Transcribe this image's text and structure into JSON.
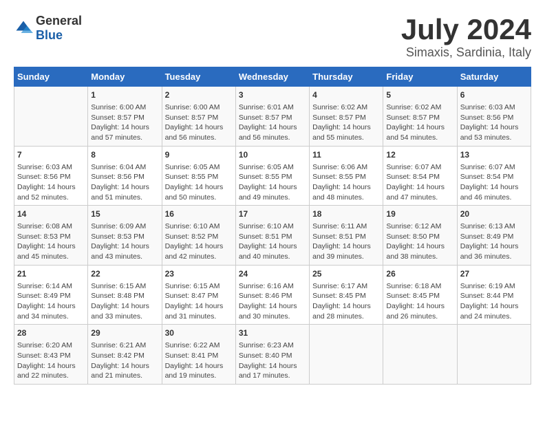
{
  "logo": {
    "text_general": "General",
    "text_blue": "Blue"
  },
  "title": "July 2024",
  "subtitle": "Simaxis, Sardinia, Italy",
  "headers": [
    "Sunday",
    "Monday",
    "Tuesday",
    "Wednesday",
    "Thursday",
    "Friday",
    "Saturday"
  ],
  "weeks": [
    [
      {
        "day": "",
        "content": ""
      },
      {
        "day": "1",
        "content": "Sunrise: 6:00 AM\nSunset: 8:57 PM\nDaylight: 14 hours\nand 57 minutes."
      },
      {
        "day": "2",
        "content": "Sunrise: 6:00 AM\nSunset: 8:57 PM\nDaylight: 14 hours\nand 56 minutes."
      },
      {
        "day": "3",
        "content": "Sunrise: 6:01 AM\nSunset: 8:57 PM\nDaylight: 14 hours\nand 56 minutes."
      },
      {
        "day": "4",
        "content": "Sunrise: 6:02 AM\nSunset: 8:57 PM\nDaylight: 14 hours\nand 55 minutes."
      },
      {
        "day": "5",
        "content": "Sunrise: 6:02 AM\nSunset: 8:57 PM\nDaylight: 14 hours\nand 54 minutes."
      },
      {
        "day": "6",
        "content": "Sunrise: 6:03 AM\nSunset: 8:56 PM\nDaylight: 14 hours\nand 53 minutes."
      }
    ],
    [
      {
        "day": "7",
        "content": "Sunrise: 6:03 AM\nSunset: 8:56 PM\nDaylight: 14 hours\nand 52 minutes."
      },
      {
        "day": "8",
        "content": "Sunrise: 6:04 AM\nSunset: 8:56 PM\nDaylight: 14 hours\nand 51 minutes."
      },
      {
        "day": "9",
        "content": "Sunrise: 6:05 AM\nSunset: 8:55 PM\nDaylight: 14 hours\nand 50 minutes."
      },
      {
        "day": "10",
        "content": "Sunrise: 6:05 AM\nSunset: 8:55 PM\nDaylight: 14 hours\nand 49 minutes."
      },
      {
        "day": "11",
        "content": "Sunrise: 6:06 AM\nSunset: 8:55 PM\nDaylight: 14 hours\nand 48 minutes."
      },
      {
        "day": "12",
        "content": "Sunrise: 6:07 AM\nSunset: 8:54 PM\nDaylight: 14 hours\nand 47 minutes."
      },
      {
        "day": "13",
        "content": "Sunrise: 6:07 AM\nSunset: 8:54 PM\nDaylight: 14 hours\nand 46 minutes."
      }
    ],
    [
      {
        "day": "14",
        "content": "Sunrise: 6:08 AM\nSunset: 8:53 PM\nDaylight: 14 hours\nand 45 minutes."
      },
      {
        "day": "15",
        "content": "Sunrise: 6:09 AM\nSunset: 8:53 PM\nDaylight: 14 hours\nand 43 minutes."
      },
      {
        "day": "16",
        "content": "Sunrise: 6:10 AM\nSunset: 8:52 PM\nDaylight: 14 hours\nand 42 minutes."
      },
      {
        "day": "17",
        "content": "Sunrise: 6:10 AM\nSunset: 8:51 PM\nDaylight: 14 hours\nand 40 minutes."
      },
      {
        "day": "18",
        "content": "Sunrise: 6:11 AM\nSunset: 8:51 PM\nDaylight: 14 hours\nand 39 minutes."
      },
      {
        "day": "19",
        "content": "Sunrise: 6:12 AM\nSunset: 8:50 PM\nDaylight: 14 hours\nand 38 minutes."
      },
      {
        "day": "20",
        "content": "Sunrise: 6:13 AM\nSunset: 8:49 PM\nDaylight: 14 hours\nand 36 minutes."
      }
    ],
    [
      {
        "day": "21",
        "content": "Sunrise: 6:14 AM\nSunset: 8:49 PM\nDaylight: 14 hours\nand 34 minutes."
      },
      {
        "day": "22",
        "content": "Sunrise: 6:15 AM\nSunset: 8:48 PM\nDaylight: 14 hours\nand 33 minutes."
      },
      {
        "day": "23",
        "content": "Sunrise: 6:15 AM\nSunset: 8:47 PM\nDaylight: 14 hours\nand 31 minutes."
      },
      {
        "day": "24",
        "content": "Sunrise: 6:16 AM\nSunset: 8:46 PM\nDaylight: 14 hours\nand 30 minutes."
      },
      {
        "day": "25",
        "content": "Sunrise: 6:17 AM\nSunset: 8:45 PM\nDaylight: 14 hours\nand 28 minutes."
      },
      {
        "day": "26",
        "content": "Sunrise: 6:18 AM\nSunset: 8:45 PM\nDaylight: 14 hours\nand 26 minutes."
      },
      {
        "day": "27",
        "content": "Sunrise: 6:19 AM\nSunset: 8:44 PM\nDaylight: 14 hours\nand 24 minutes."
      }
    ],
    [
      {
        "day": "28",
        "content": "Sunrise: 6:20 AM\nSunset: 8:43 PM\nDaylight: 14 hours\nand 22 minutes."
      },
      {
        "day": "29",
        "content": "Sunrise: 6:21 AM\nSunset: 8:42 PM\nDaylight: 14 hours\nand 21 minutes."
      },
      {
        "day": "30",
        "content": "Sunrise: 6:22 AM\nSunset: 8:41 PM\nDaylight: 14 hours\nand 19 minutes."
      },
      {
        "day": "31",
        "content": "Sunrise: 6:23 AM\nSunset: 8:40 PM\nDaylight: 14 hours\nand 17 minutes."
      },
      {
        "day": "",
        "content": ""
      },
      {
        "day": "",
        "content": ""
      },
      {
        "day": "",
        "content": ""
      }
    ]
  ]
}
